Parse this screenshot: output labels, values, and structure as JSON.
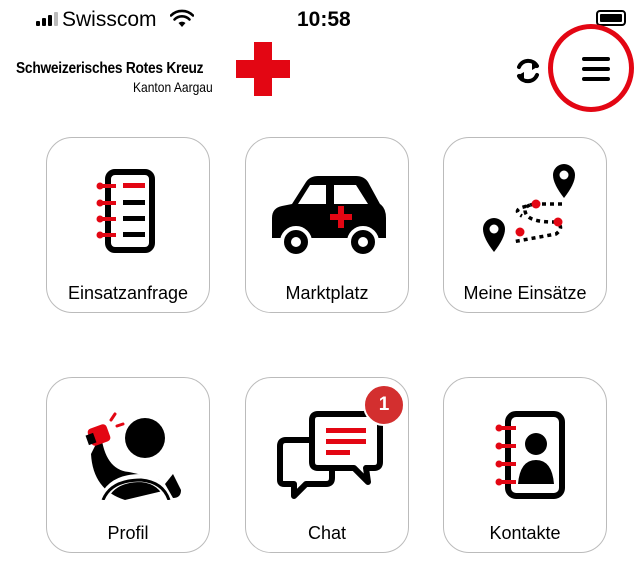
{
  "status_bar": {
    "carrier": "Swisscom",
    "time": "10:58"
  },
  "header": {
    "org_name": "Schweizerisches Rotes Kreuz",
    "org_subtitle": "Kanton Aargau",
    "logo_icon": "red-cross-icon",
    "sync_icon": "sync-icon",
    "menu_icon": "hamburger-menu-icon",
    "highlight_color": "#e30613"
  },
  "tiles": [
    {
      "label": "Einsatzanfrage",
      "icon": "notebook-icon"
    },
    {
      "label": "Marktplatz",
      "icon": "ambulance-car-icon"
    },
    {
      "label": "Meine Einsätze",
      "icon": "route-map-icon"
    },
    {
      "label": "Profil",
      "icon": "driver-profile-icon"
    },
    {
      "label": "Chat",
      "icon": "chat-bubbles-icon",
      "badge": "1"
    },
    {
      "label": "Kontakte",
      "icon": "contact-book-icon"
    }
  ]
}
